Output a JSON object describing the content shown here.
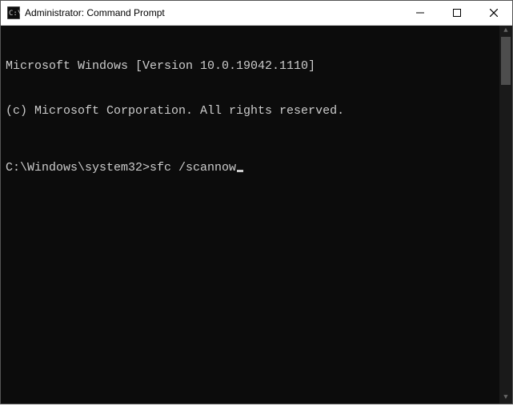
{
  "window": {
    "title": "Administrator: Command Prompt",
    "icon": "cmd-icon"
  },
  "controls": {
    "minimize": "minimize",
    "maximize": "maximize",
    "close": "close"
  },
  "terminal": {
    "lines": [
      "Microsoft Windows [Version 10.0.19042.1110]",
      "(c) Microsoft Corporation. All rights reserved."
    ],
    "prompt": "C:\\Windows\\system32>",
    "command": "sfc /scannow"
  },
  "colors": {
    "terminal_bg": "#0c0c0c",
    "terminal_fg": "#cccccc",
    "titlebar_bg": "#ffffff"
  }
}
